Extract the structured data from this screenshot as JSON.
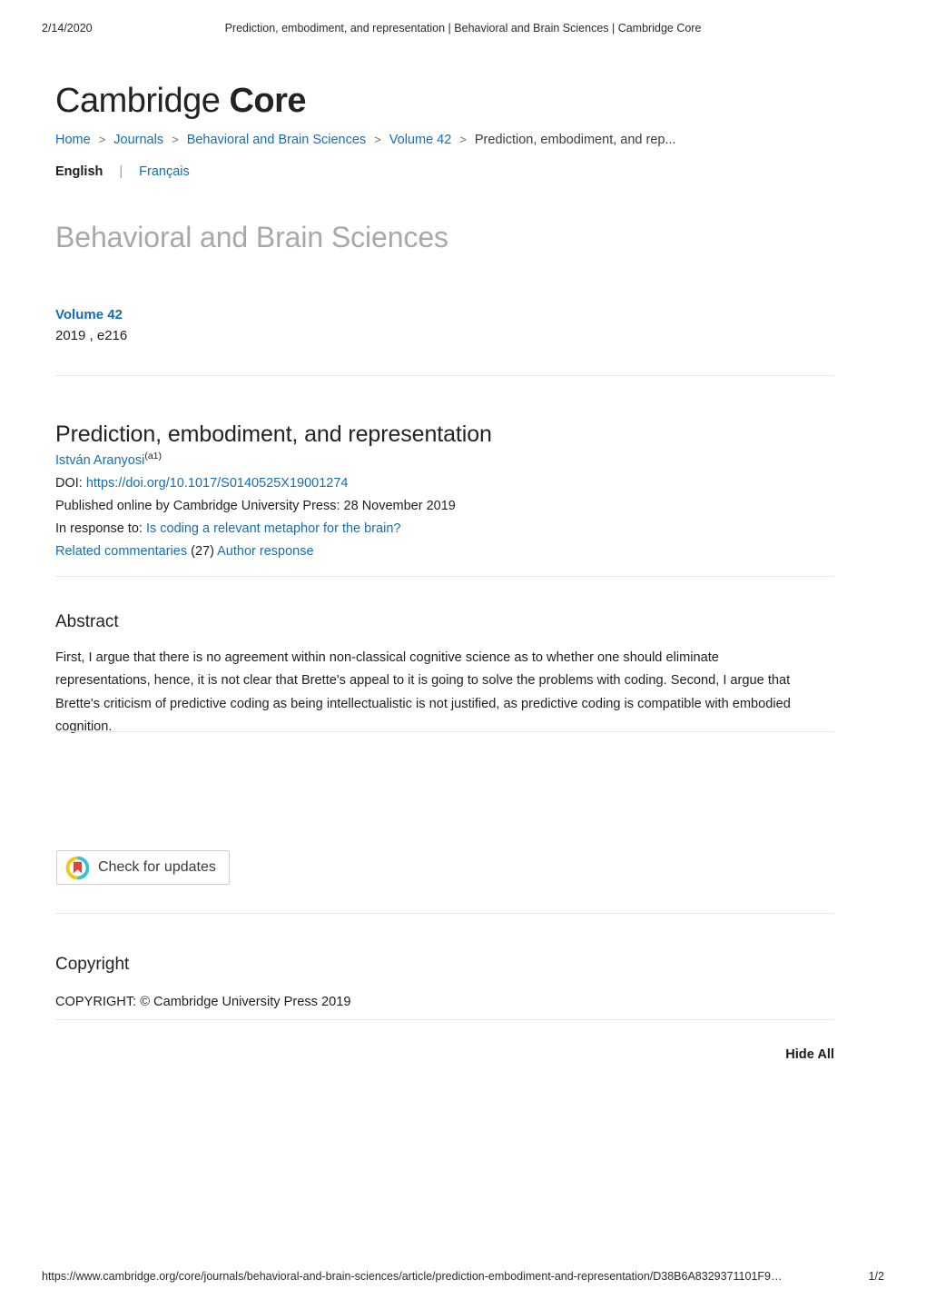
{
  "print_header": {
    "date": "2/14/2020",
    "title": "Prediction, embodiment, and representation | Behavioral and Brain Sciences | Cambridge Core"
  },
  "brand": {
    "word_light": "Cambridge",
    "word_bold": "Core"
  },
  "breadcrumb": {
    "separator": ">",
    "items": [
      {
        "label": "Home",
        "link": true
      },
      {
        "label": "Journals",
        "link": true
      },
      {
        "label": "Behavioral and Brain Sciences",
        "link": true
      },
      {
        "label": "Volume 42",
        "link": true
      },
      {
        "label": "Prediction, embodiment, and rep...",
        "link": false
      }
    ]
  },
  "language": {
    "active": "English",
    "divider": "|",
    "alternate": "Français"
  },
  "journal": {
    "title": "Behavioral and Brain Sciences"
  },
  "volume": {
    "label": "Volume 42",
    "issue_line": "2019 , e216"
  },
  "article": {
    "title": "Prediction, embodiment, and representation",
    "author": "István Aranyosi",
    "author_affiliation": "(a1)",
    "doi_label": "DOI:",
    "doi_url": "https://doi.org/10.1017/S0140525X19001274",
    "published_line": "Published online by Cambridge University Press: 28 November 2019",
    "response_label": "In response to:",
    "response_target": "Is coding a relevant metaphor for the brain?",
    "related_commentaries_label": "Related commentaries",
    "related_commentaries_count": "(27)",
    "author_response_label": "Author response"
  },
  "abstract": {
    "heading": "Abstract",
    "text": "First, I argue that there is no agreement within non-classical cognitive science as to whether one should eliminate representations, hence, it is not clear that Brette's appeal to it is going to solve the problems with coding. Second, I argue that Brette's criticism of predictive coding as being intellectualistic is not justified, as predictive coding is compatible with embodied cognition."
  },
  "crossmark": {
    "label": "Check for updates",
    "icon": "crossmark-icon",
    "colors": {
      "ring_yellow": "#f5c518",
      "ring_cyan": "#2ec4d9",
      "bookmark_red": "#e8413c"
    }
  },
  "copyright": {
    "heading": "Copyright",
    "text": "COPYRIGHT: © Cambridge University Press 2019"
  },
  "controls": {
    "hide_all": "Hide All"
  },
  "print_footer": {
    "url": "https://www.cambridge.org/core/journals/behavioral-and-brain-sciences/article/prediction-embodiment-and-representation/D38B6A8329371101F9…",
    "page": "1/2"
  },
  "theme": {
    "link": "#176db7",
    "text": "#1f1f1f",
    "muted": "#a8a8a8",
    "rule": "#e4e4e4"
  }
}
